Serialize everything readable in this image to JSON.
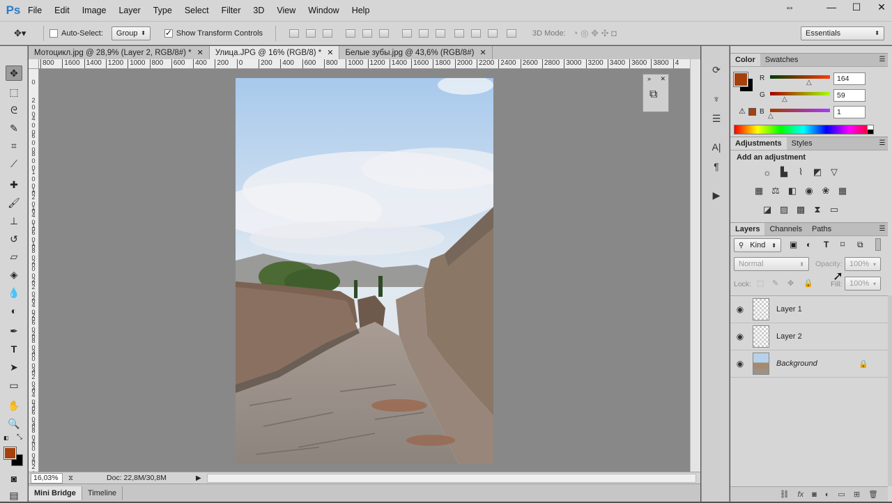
{
  "app": {
    "logo": "Ps"
  },
  "menu": [
    "File",
    "Edit",
    "Image",
    "Layer",
    "Type",
    "Select",
    "Filter",
    "3D",
    "View",
    "Window",
    "Help"
  ],
  "window_controls": {
    "move": "⇔",
    "minimize": "—",
    "maximize": "☐",
    "close": "✕"
  },
  "options_bar": {
    "auto_select_label": "Auto-Select:",
    "auto_select_checked": false,
    "group_value": "Group",
    "show_transform_label": "Show Transform Controls",
    "show_transform_checked": true,
    "mode_3d_label": "3D Mode:",
    "workspace_value": "Essentials"
  },
  "tabs": [
    {
      "label": "Мотоцикл.jpg @ 28,9% (Layer 2, RGB/8#) *",
      "active": false
    },
    {
      "label": "Улица.JPG @ 16% (RGB/8) *",
      "active": true
    },
    {
      "label": "Белые зубы.jpg @ 43,6% (RGB/8#)",
      "active": false
    }
  ],
  "ruler_h": [
    "800",
    "1600",
    "1400",
    "1200",
    "1000",
    "800",
    "600",
    "400",
    "200",
    "0",
    "200",
    "400",
    "600",
    "800",
    "1000",
    "1200",
    "1400",
    "1600",
    "1800",
    "2000",
    "2200",
    "2400",
    "2600",
    "2800",
    "3000",
    "3200",
    "3400",
    "3600",
    "3800",
    "4"
  ],
  "ruler_v": [
    "0",
    "2 0 0",
    "4 0 0",
    "6 0 0",
    "8 0 0",
    "1 0 0 0",
    "1 2 0 0",
    "1 4 0 0",
    "1 6 0 0",
    "1 8 0 0",
    "2 0 0 0",
    "2 2 0 0",
    "2 4 0 0",
    "2 6 0 0",
    "2 8 0 0",
    "3 0 0 0",
    "3 2 0 0",
    "3 4 0 0",
    "3 6 0 0",
    "3 8 0 0",
    "4 0 0 0",
    "4 2 0 0"
  ],
  "status": {
    "zoom": "16,03%",
    "doc": "Doc: 22,8M/30,8M"
  },
  "bottom_tabs": [
    "Mini Bridge",
    "Timeline"
  ],
  "color_panel": {
    "tabs": [
      "Color",
      "Swatches"
    ],
    "foreground": "#a5410e",
    "background": "#000000",
    "r_label": "R",
    "r": "164",
    "g_label": "G",
    "g": "59",
    "b_label": "B",
    "b": "1"
  },
  "adjustments_panel": {
    "tabs": [
      "Adjustments",
      "Styles"
    ],
    "heading": "Add an adjustment"
  },
  "layers_panel": {
    "tabs": [
      "Layers",
      "Channels",
      "Paths"
    ],
    "kind_label": "Kind",
    "blend_mode": "Normal",
    "opacity_label": "Opacity:",
    "opacity": "100%",
    "lock_label": "Lock:",
    "fill_label": "Fill:",
    "fill": "100%",
    "layers": [
      {
        "name": "Layer 1",
        "type": "transparent"
      },
      {
        "name": "Layer 2",
        "type": "transparent"
      },
      {
        "name": "Background",
        "type": "photo",
        "locked": true
      }
    ]
  }
}
